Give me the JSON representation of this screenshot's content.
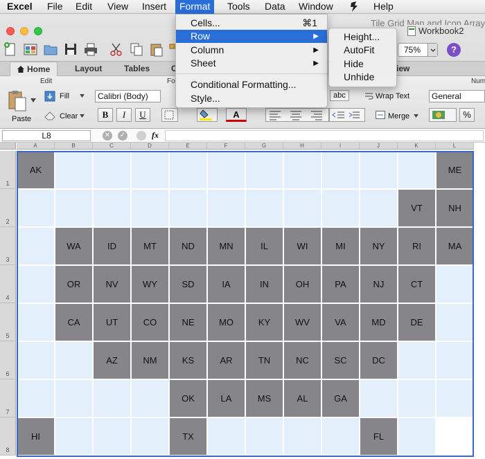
{
  "menubar": {
    "app": "Excel",
    "items": [
      "File",
      "Edit",
      "View",
      "Insert",
      "Format",
      "Tools",
      "Data",
      "Window",
      "Help"
    ],
    "active": "Format"
  },
  "window": {
    "title_left": "Tile Grid Map and Icon Array",
    "title_right": "Workbook2"
  },
  "toolbar": {
    "zoom": "75%",
    "help_label": "?"
  },
  "ribbon": {
    "tabs": [
      "Home",
      "Layout",
      "Tables",
      "C",
      "iew"
    ],
    "selected_tab": "Home",
    "groups": {
      "edit": "Edit",
      "font": "Fo",
      "number": "Num"
    },
    "paste": "Paste",
    "fill": "Fill",
    "clear": "Clear",
    "font_name": "Calibri (Body)",
    "bold": "B",
    "italic": "I",
    "underline": "U",
    "font_color": "A",
    "wrap_text": "Wrap Text",
    "merge": "Merge",
    "abc": "abc",
    "number_format": "General",
    "percent": "%"
  },
  "formula_bar": {
    "name_box": "L8",
    "fx": "fx",
    "cancel": "✕",
    "confirm": "✓"
  },
  "sheet": {
    "columns": [
      "A",
      "B",
      "C",
      "D",
      "E",
      "F",
      "G",
      "H",
      "I",
      "J",
      "K",
      "L"
    ],
    "rows": [
      "1",
      "2",
      "3",
      "4",
      "5",
      "6",
      "7",
      "8"
    ],
    "tiles": [
      [
        "AK",
        "",
        "",
        "",
        "",
        "",
        "",
        "",
        "",
        "",
        "",
        "ME"
      ],
      [
        "",
        "",
        "",
        "",
        "",
        "",
        "",
        "",
        "",
        "",
        "VT",
        "NH"
      ],
      [
        "",
        "WA",
        "ID",
        "MT",
        "ND",
        "MN",
        "IL",
        "WI",
        "MI",
        "NY",
        "RI",
        "MA"
      ],
      [
        "",
        "OR",
        "NV",
        "WY",
        "SD",
        "IA",
        "IN",
        "OH",
        "PA",
        "NJ",
        "CT",
        ""
      ],
      [
        "",
        "CA",
        "UT",
        "CO",
        "NE",
        "MO",
        "KY",
        "WV",
        "VA",
        "MD",
        "DE",
        ""
      ],
      [
        "",
        "",
        "AZ",
        "NM",
        "KS",
        "AR",
        "TN",
        "NC",
        "SC",
        "DC",
        "",
        ""
      ],
      [
        "",
        "",
        "",
        "",
        "OK",
        "LA",
        "MS",
        "AL",
        "GA",
        "",
        "",
        ""
      ],
      [
        "HI",
        "",
        "",
        "",
        "TX",
        "",
        "",
        "",
        "",
        "FL",
        "",
        ""
      ]
    ],
    "tile_color": "#86868a",
    "empty_color": "#e3f0fc"
  },
  "format_menu": {
    "items": [
      {
        "label": "Cells...",
        "shortcut": "⌘1"
      },
      {
        "label": "Row",
        "submenu": true,
        "highlighted": true
      },
      {
        "label": "Column",
        "submenu": true
      },
      {
        "label": "Sheet",
        "submenu": true
      },
      {
        "label": "Conditional Formatting..."
      },
      {
        "label": "Style..."
      }
    ]
  },
  "row_submenu": {
    "items": [
      "Height...",
      "AutoFit",
      "Hide",
      "Unhide"
    ]
  },
  "colors": {
    "accent": "#2a6ed8",
    "selection_border": "#3a66c4"
  }
}
